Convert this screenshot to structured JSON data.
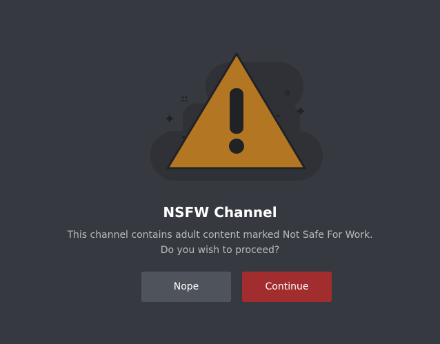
{
  "colors": {
    "background": "#36393f",
    "warning_triangle": "#b37724",
    "nope_button": "#4f545c",
    "continue_button": "#a12d2f"
  },
  "illustration": {
    "icon": "warning-triangle-icon"
  },
  "dialog": {
    "title": "NSFW Channel",
    "description_line1": "This channel contains adult content marked Not Safe For Work.",
    "description_line2": "Do you wish to proceed?"
  },
  "buttons": {
    "nope_label": "Nope",
    "continue_label": "Continue"
  }
}
